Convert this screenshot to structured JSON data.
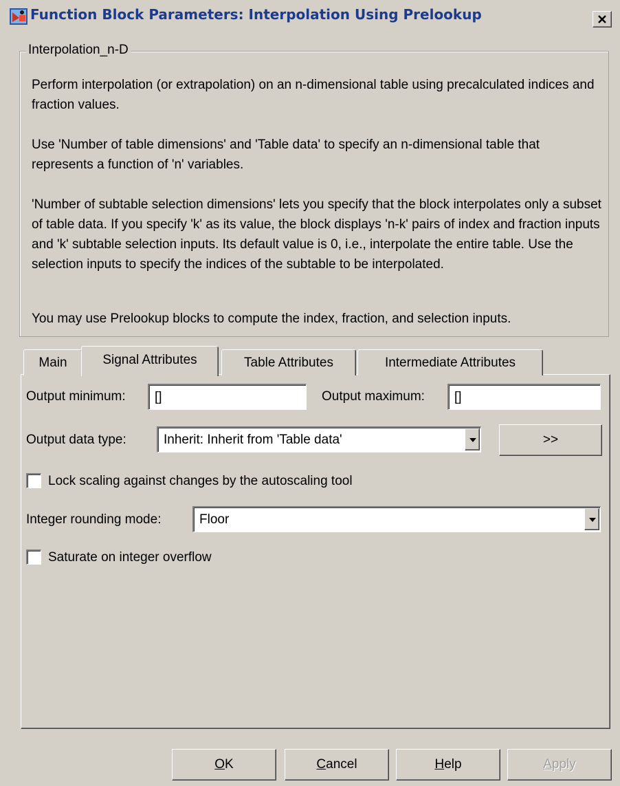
{
  "window": {
    "title": "Function Block Parameters: Interpolation Using Prelookup"
  },
  "description": {
    "group_title": "Interpolation_n-D",
    "paragraphs": [
      "Perform interpolation (or extrapolation) on an n-dimensional table using precalculated indices and fraction values.",
      "Use 'Number of table dimensions' and 'Table data' to specify an n-dimensional table that represents a function of 'n' variables.",
      "'Number of subtable selection dimensions' lets you specify that the block interpolates only a subset of table data. If you specify 'k' as its value, the block displays 'n-k' pairs of index and fraction inputs and 'k' subtable selection inputs. Its default value is 0, i.e., interpolate the entire table. Use the selection inputs to specify the indices of the subtable to be interpolated.",
      "You may use Prelookup blocks to compute the index, fraction, and selection inputs."
    ]
  },
  "tabs": [
    {
      "label": "Main",
      "active": false
    },
    {
      "label": "Signal Attributes",
      "active": true
    },
    {
      "label": "Table Attributes",
      "active": false
    },
    {
      "label": "Intermediate Attributes",
      "active": false
    }
  ],
  "signal_attributes": {
    "output_min_label": "Output minimum:",
    "output_min_value": "[]",
    "output_max_label": "Output maximum:",
    "output_max_value": "[]",
    "output_dtype_label": "Output data type:",
    "output_dtype_value": "Inherit: Inherit from 'Table data'",
    "dtype_assistant_label": ">>",
    "lock_scaling_label": "Lock scaling against changes by the autoscaling tool",
    "lock_scaling_checked": false,
    "rounding_label": "Integer rounding mode:",
    "rounding_value": "Floor",
    "saturate_label": "Saturate on integer overflow",
    "saturate_checked": false
  },
  "buttons": {
    "ok": {
      "pre": "",
      "mnemonic": "O",
      "post": "K"
    },
    "cancel": {
      "pre": "",
      "mnemonic": "C",
      "post": "ancel"
    },
    "help": {
      "pre": "",
      "mnemonic": "H",
      "post": "elp"
    },
    "apply": {
      "pre": "",
      "mnemonic": "A",
      "post": "pply",
      "enabled": false
    }
  },
  "colors": {
    "dialog_bg": "#d4d0c8",
    "title_text": "#1c3b8f"
  },
  "icons": [
    "simulink-block-icon",
    "close-icon",
    "dropdown-arrow-icon"
  ]
}
